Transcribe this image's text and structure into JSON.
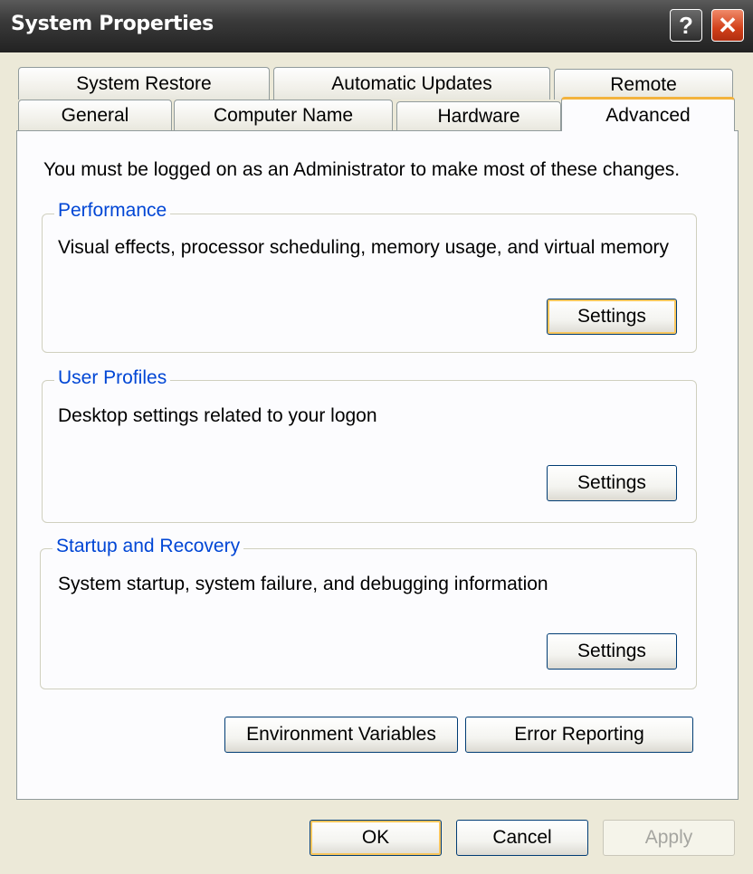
{
  "window": {
    "title": "System Properties",
    "help_glyph": "?",
    "close_glyph": "✕"
  },
  "tabs_row1": [
    {
      "label": "System Restore"
    },
    {
      "label": "Automatic Updates"
    },
    {
      "label": "Remote"
    }
  ],
  "tabs_row2": [
    {
      "label": "General"
    },
    {
      "label": "Computer Name"
    },
    {
      "label": "Hardware"
    },
    {
      "label": "Advanced",
      "active": true
    }
  ],
  "notice": "You must be logged on as an Administrator to make most of these changes.",
  "performance": {
    "title": "Performance",
    "desc": "Visual effects, processor scheduling, memory usage, and virtual memory",
    "button": "Settings"
  },
  "user_profiles": {
    "title": "User Profiles",
    "desc": "Desktop settings related to your logon",
    "button": "Settings"
  },
  "startup_recovery": {
    "title": "Startup and Recovery",
    "desc": "System startup, system failure, and debugging information",
    "button": "Settings"
  },
  "env_vars_button": "Environment Variables",
  "error_reporting_button": "Error Reporting",
  "footer": {
    "ok": "OK",
    "cancel": "Cancel",
    "apply": "Apply"
  },
  "colors": {
    "accent_tab": "#f3b33d",
    "group_title": "#0046d5",
    "close_button": "#d2401a"
  }
}
